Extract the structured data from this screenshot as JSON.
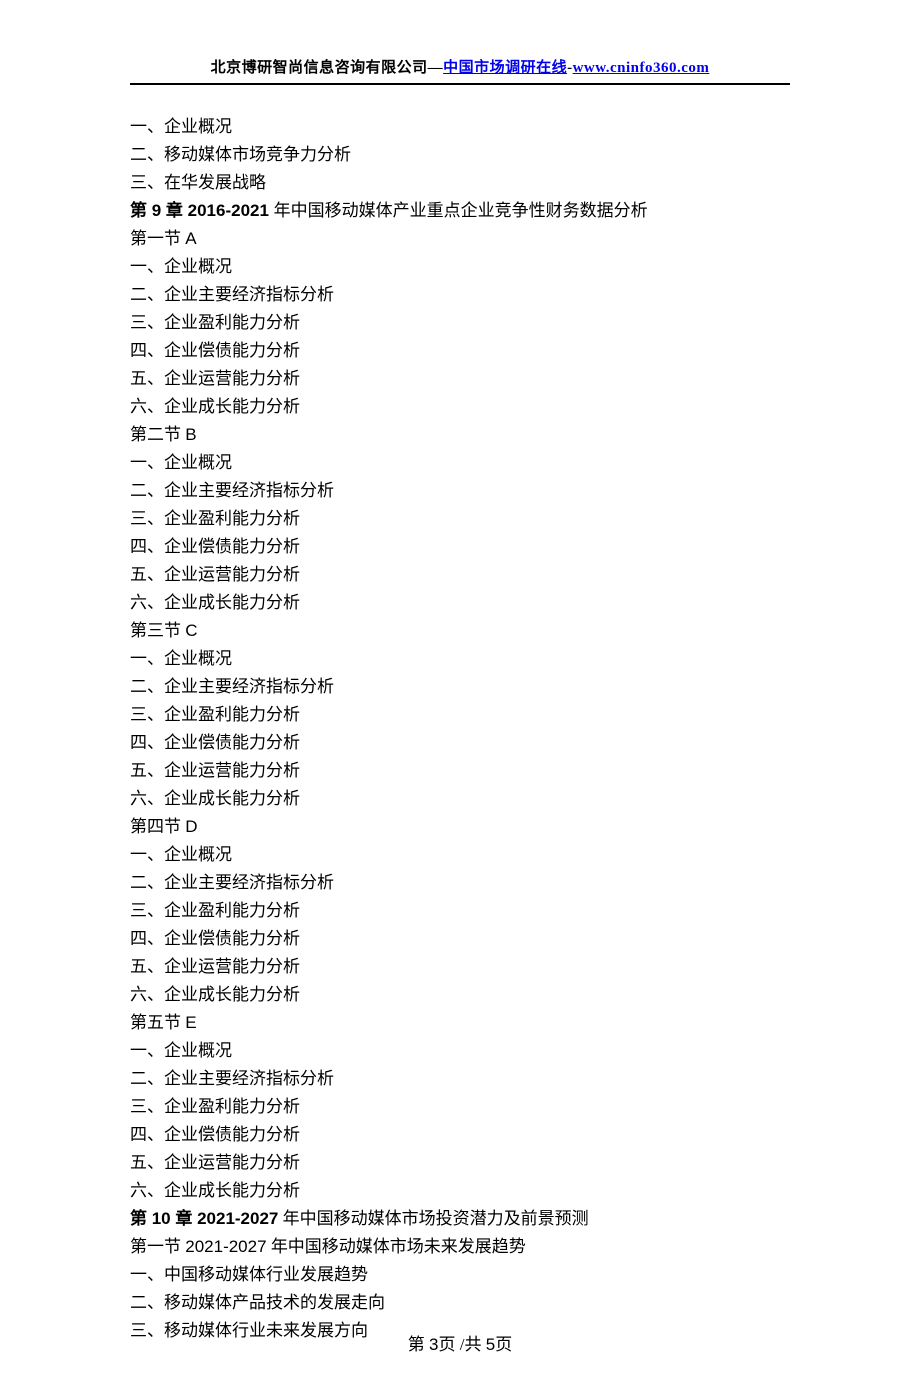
{
  "header": {
    "company": "北京博研智尚信息咨询有限公司—",
    "link1_text": "中国市场调研在线",
    "sep": "-",
    "link2_text": "www.cninfo360.com"
  },
  "lines": [
    "一、企业概况",
    "二、移动媒体市场竞争力分析",
    "三、在华发展战略"
  ],
  "chapter9": {
    "prefix": "第",
    "num": " 9 ",
    "suffix": "章  2016-2021 ",
    "rest": "年中国移动媒体产业重点企业竞争性财务数据分析"
  },
  "sections": [
    {
      "title": "第一节   A",
      "items": [
        "一、企业概况",
        "二、企业主要经济指标分析",
        "三、企业盈利能力分析",
        "四、企业偿债能力分析",
        "五、企业运营能力分析",
        "六、企业成长能力分析"
      ]
    },
    {
      "title": "第二节   B",
      "items": [
        "一、企业概况",
        "二、企业主要经济指标分析",
        "三、企业盈利能力分析",
        "四、企业偿债能力分析",
        "五、企业运营能力分析",
        "六、企业成长能力分析"
      ]
    },
    {
      "title": "第三节   C",
      "items": [
        "一、企业概况",
        "二、企业主要经济指标分析",
        "三、企业盈利能力分析",
        "四、企业偿债能力分析",
        "五、企业运营能力分析",
        "六、企业成长能力分析"
      ]
    },
    {
      "title": "第四节   D",
      "items": [
        "一、企业概况",
        "二、企业主要经济指标分析",
        "三、企业盈利能力分析",
        "四、企业偿债能力分析",
        "五、企业运营能力分析",
        "六、企业成长能力分析"
      ]
    },
    {
      "title": "第五节   E",
      "items": [
        "一、企业概况",
        "二、企业主要经济指标分析",
        "三、企业盈利能力分析",
        "四、企业偿债能力分析",
        "五、企业运营能力分析",
        "六、企业成长能力分析"
      ]
    }
  ],
  "chapter10": {
    "prefix": "第",
    "num": " 10 ",
    "suffix": "章  2021-2027",
    "rest": " 年中国移动媒体市场投资潜力及前景预测"
  },
  "after10": [
    "第一节   2021-2027 年中国移动媒体市场未来发展趋势",
    "一、中国移动媒体行业发展趋势",
    "二、移动媒体产品技术的发展走向",
    "三、移动媒体行业未来发展方向"
  ],
  "footer": {
    "p1": "第  ",
    "cur": "3",
    "p2": "页  /共  ",
    "total": "5",
    "p3": "页"
  }
}
